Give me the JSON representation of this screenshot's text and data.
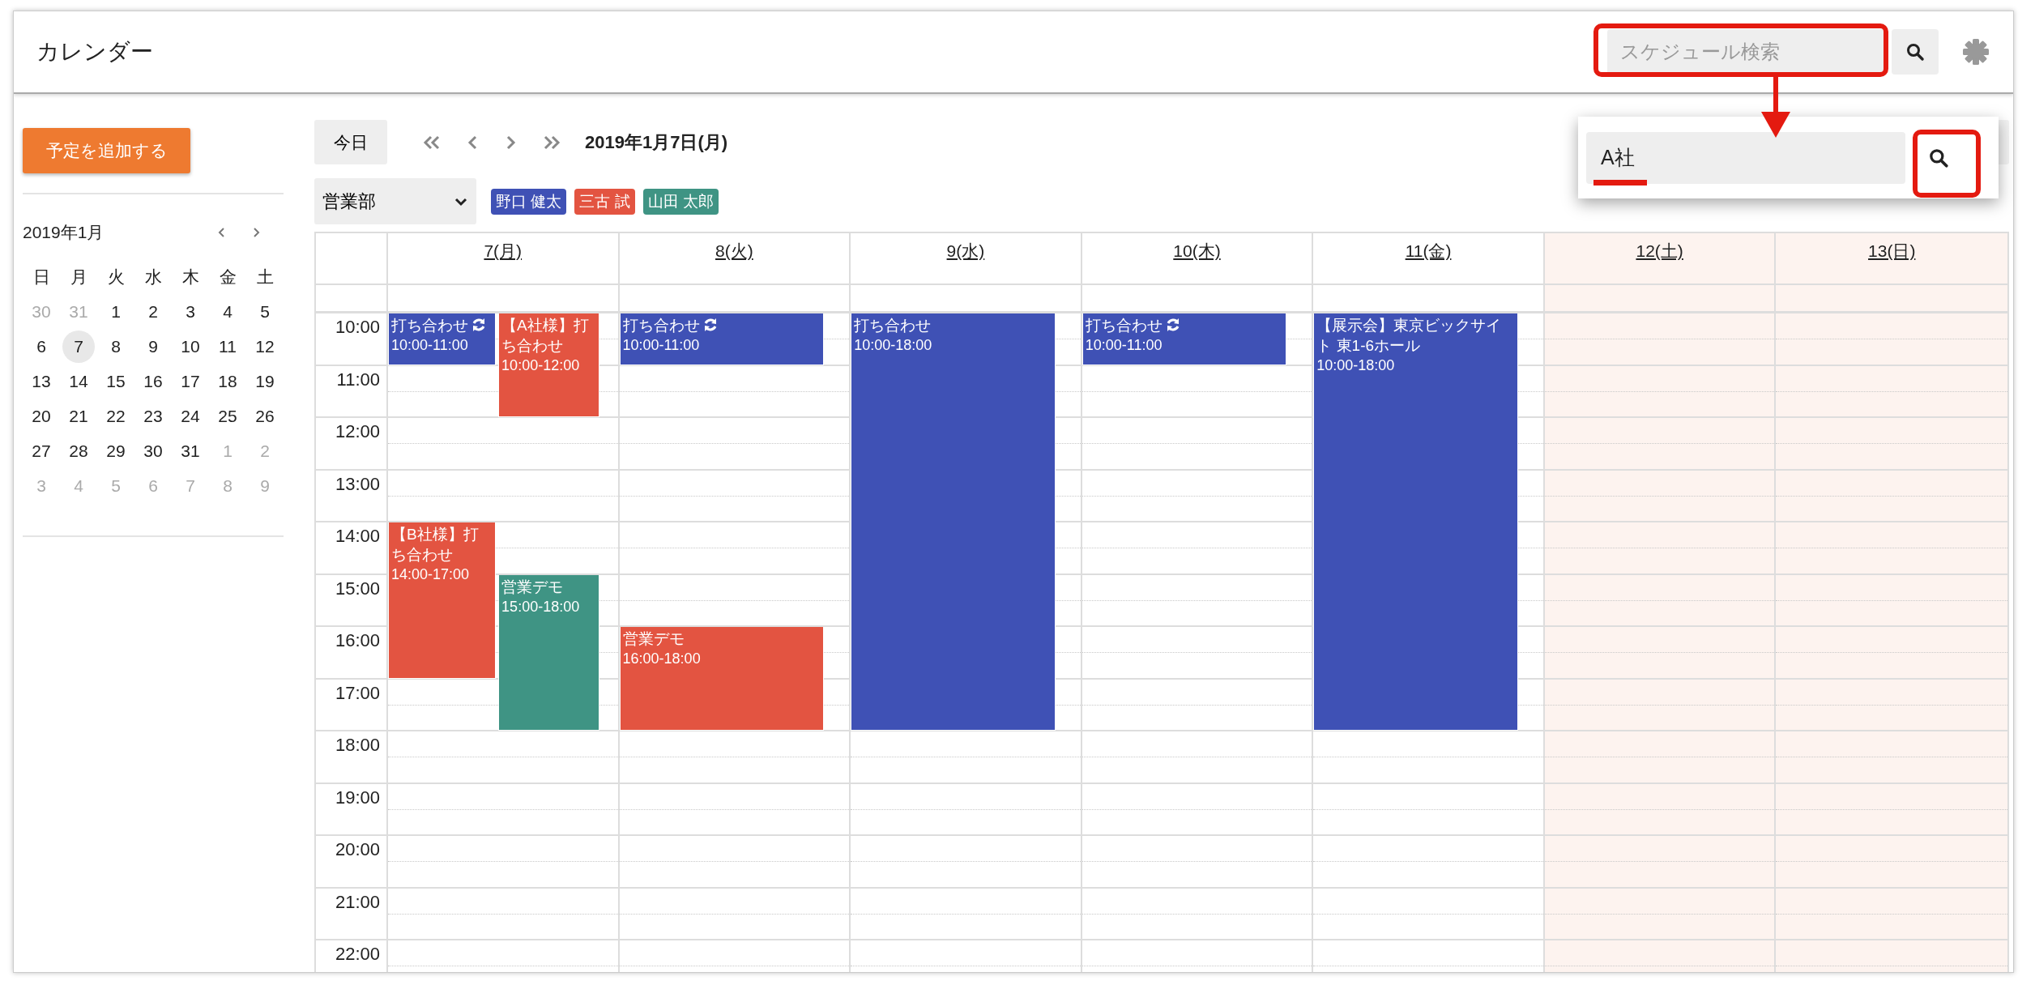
{
  "header": {
    "title": "カレンダー",
    "search": {
      "placeholder": "スケジュール検索"
    }
  },
  "sidebar": {
    "add_button": "予定を追加する",
    "mini_calendar": {
      "title": "2019年1月",
      "weekdays": [
        "日",
        "月",
        "火",
        "水",
        "木",
        "金",
        "土"
      ],
      "weeks": [
        [
          {
            "day": "30",
            "other_month": true,
            "selected": false
          },
          {
            "day": "31",
            "other_month": true,
            "selected": false
          },
          {
            "day": "1",
            "other_month": false,
            "selected": false
          },
          {
            "day": "2",
            "other_month": false,
            "selected": false
          },
          {
            "day": "3",
            "other_month": false,
            "selected": false
          },
          {
            "day": "4",
            "other_month": false,
            "selected": false
          },
          {
            "day": "5",
            "other_month": false,
            "selected": false
          }
        ],
        [
          {
            "day": "6",
            "other_month": false,
            "selected": false
          },
          {
            "day": "7",
            "other_month": false,
            "selected": true
          },
          {
            "day": "8",
            "other_month": false,
            "selected": false
          },
          {
            "day": "9",
            "other_month": false,
            "selected": false
          },
          {
            "day": "10",
            "other_month": false,
            "selected": false
          },
          {
            "day": "11",
            "other_month": false,
            "selected": false
          },
          {
            "day": "12",
            "other_month": false,
            "selected": false
          }
        ],
        [
          {
            "day": "13",
            "other_month": false,
            "selected": false
          },
          {
            "day": "14",
            "other_month": false,
            "selected": false
          },
          {
            "day": "15",
            "other_month": false,
            "selected": false
          },
          {
            "day": "16",
            "other_month": false,
            "selected": false
          },
          {
            "day": "17",
            "other_month": false,
            "selected": false
          },
          {
            "day": "18",
            "other_month": false,
            "selected": false
          },
          {
            "day": "19",
            "other_month": false,
            "selected": false
          }
        ],
        [
          {
            "day": "20",
            "other_month": false,
            "selected": false
          },
          {
            "day": "21",
            "other_month": false,
            "selected": false
          },
          {
            "day": "22",
            "other_month": false,
            "selected": false
          },
          {
            "day": "23",
            "other_month": false,
            "selected": false
          },
          {
            "day": "24",
            "other_month": false,
            "selected": false
          },
          {
            "day": "25",
            "other_month": false,
            "selected": false
          },
          {
            "day": "26",
            "other_month": false,
            "selected": false
          }
        ],
        [
          {
            "day": "27",
            "other_month": false,
            "selected": false
          },
          {
            "day": "28",
            "other_month": false,
            "selected": false
          },
          {
            "day": "29",
            "other_month": false,
            "selected": false
          },
          {
            "day": "30",
            "other_month": false,
            "selected": false
          },
          {
            "day": "31",
            "other_month": false,
            "selected": false
          },
          {
            "day": "1",
            "other_month": true,
            "selected": false
          },
          {
            "day": "2",
            "other_month": true,
            "selected": false
          }
        ],
        [
          {
            "day": "3",
            "other_month": true,
            "selected": false
          },
          {
            "day": "4",
            "other_month": true,
            "selected": false
          },
          {
            "day": "5",
            "other_month": true,
            "selected": false
          },
          {
            "day": "6",
            "other_month": true,
            "selected": false
          },
          {
            "day": "7",
            "other_month": true,
            "selected": false
          },
          {
            "day": "8",
            "other_month": true,
            "selected": false
          },
          {
            "day": "9",
            "other_month": true,
            "selected": false
          }
        ]
      ]
    }
  },
  "toolbar": {
    "today_button": "今日",
    "date": "2019年1月7日(月)"
  },
  "filter": {
    "department": "営業部",
    "members": [
      {
        "name": "野口 健太",
        "color": "#3f51b5"
      },
      {
        "name": "三古 試",
        "color": "#e35441"
      },
      {
        "name": "山田 太郎",
        "color": "#3f9484"
      }
    ]
  },
  "calendar": {
    "hours": [
      "10:00",
      "11:00",
      "12:00",
      "13:00",
      "14:00",
      "15:00",
      "16:00",
      "17:00",
      "18:00",
      "19:00",
      "20:00",
      "21:00",
      "22:00"
    ],
    "days": [
      {
        "label": "7(月)",
        "weekend": false,
        "events": [
          {
            "title": "打ち合わせ",
            "time": "10:00-11:00",
            "color": "#3f51b5",
            "recurring": true
          },
          {
            "title": "【A社様】打ち合わせ",
            "time": "10:00-12:00",
            "color": "#e35441",
            "recurring": false
          },
          {
            "title": "【B社様】打ち合わせ",
            "time": "14:00-17:00",
            "color": "#e35441",
            "recurring": false
          },
          {
            "title": "営業デモ",
            "time": "15:00-18:00",
            "color": "#3f9484",
            "recurring": false
          }
        ]
      },
      {
        "label": "8(火)",
        "weekend": false,
        "events": [
          {
            "title": "打ち合わせ",
            "time": "10:00-11:00",
            "color": "#3f51b5",
            "recurring": true
          },
          {
            "title": "営業デモ",
            "time": "16:00-18:00",
            "color": "#e35441",
            "recurring": false
          }
        ]
      },
      {
        "label": "9(水)",
        "weekend": false,
        "events": [
          {
            "title": "打ち合わせ",
            "time": "10:00-18:00",
            "color": "#3f51b5",
            "recurring": false
          }
        ]
      },
      {
        "label": "10(木)",
        "weekend": false,
        "events": [
          {
            "title": "打ち合わせ",
            "time": "10:00-11:00",
            "color": "#3f51b5",
            "recurring": true
          }
        ]
      },
      {
        "label": "11(金)",
        "weekend": false,
        "events": [
          {
            "title": "【展示会】東京ビックサイト 東1-6ホール",
            "time": "10:00-18:00",
            "color": "#3f51b5",
            "recurring": false
          }
        ]
      },
      {
        "label": "12(土)",
        "weekend": true
      },
      {
        "label": "13(日)",
        "weekend": true
      }
    ]
  },
  "search_popup": {
    "value": "A社"
  }
}
